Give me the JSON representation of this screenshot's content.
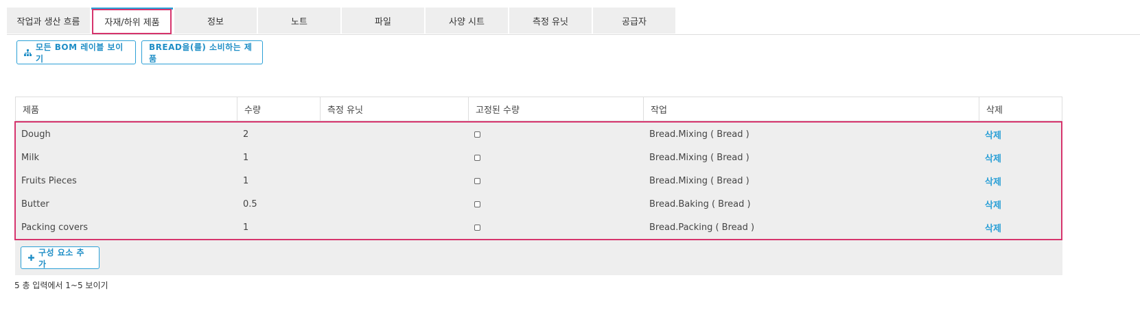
{
  "tabs": [
    {
      "label": "작업과 생산 흐름",
      "active": false
    },
    {
      "label": "자재/하위 제품",
      "active": true
    },
    {
      "label": "정보",
      "active": false
    },
    {
      "label": "노트",
      "active": false
    },
    {
      "label": "파일",
      "active": false
    },
    {
      "label": "사양 시트",
      "active": false
    },
    {
      "label": "측정 유닛",
      "active": false
    },
    {
      "label": "공급자",
      "active": false
    }
  ],
  "toolbar": {
    "show_bom_label": "모든 BOM 레이블 보이기",
    "show_bom_icon": "sitemap-icon",
    "consumers_label": "BREAD을(를) 소비하는 제품"
  },
  "table": {
    "columns": [
      "제품",
      "수량",
      "측정 유닛",
      "고정된 수량",
      "작업",
      "삭제"
    ],
    "rows": [
      {
        "product": "Dough",
        "quantity": "2",
        "unit": "",
        "fixed": false,
        "operation": "Bread.Mixing ( Bread )",
        "delete": "삭제"
      },
      {
        "product": "Milk",
        "quantity": "1",
        "unit": "",
        "fixed": false,
        "operation": "Bread.Mixing ( Bread )",
        "delete": "삭제"
      },
      {
        "product": "Fruits Pieces",
        "quantity": "1",
        "unit": "",
        "fixed": false,
        "operation": "Bread.Mixing ( Bread )",
        "delete": "삭제"
      },
      {
        "product": "Butter",
        "quantity": "0.5",
        "unit": "",
        "fixed": false,
        "operation": "Bread.Baking ( Bread )",
        "delete": "삭제"
      },
      {
        "product": "Packing covers",
        "quantity": "1",
        "unit": "",
        "fixed": false,
        "operation": "Bread.Packing ( Bread )",
        "delete": "삭제"
      }
    ],
    "add_component_label": "구성 요소 추가",
    "add_component_icon": "plus-icon"
  },
  "footer": {
    "summary": "5 총 입력에서 1~5 보이기"
  },
  "colors": {
    "accent": "#2a9fd6",
    "highlight": "#d6336c",
    "tab_bg": "#eeeeee",
    "grid_bg": "#eeeeee"
  }
}
